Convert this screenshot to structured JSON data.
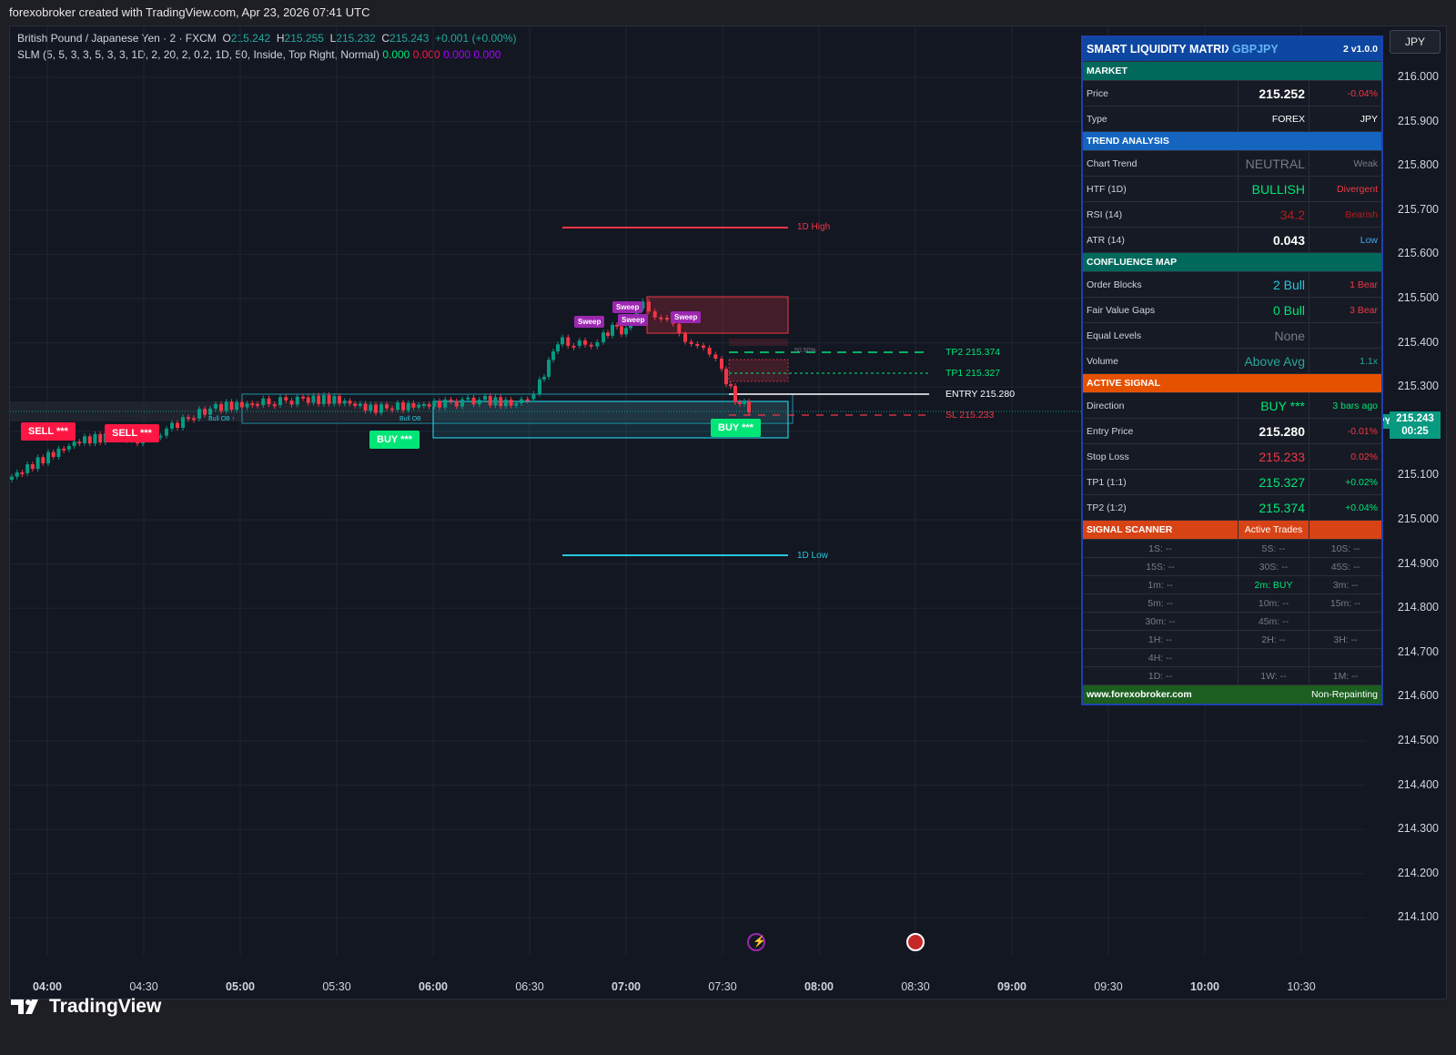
{
  "header": {
    "title": "forexobroker created with TradingView.com, Apr 23, 2026 07:41 UTC"
  },
  "legend": {
    "symbol": "British Pound / Japanese Yen · 2 · FXCM",
    "o_label": "O",
    "o": "215.242",
    "h_label": "H",
    "h": "215.255",
    "l_label": "L",
    "l": "215.232",
    "c_label": "C",
    "c": "215.243",
    "change": "+0.001 (+0.00%)",
    "indicator": "SLM (5, 5, 3, 3, 5, 3, 3, 1D, 2, 20, 2, 0.2, 1D, 50, Inside, Top Right, Normal)",
    "ind_v1": "0.000",
    "ind_v2": "0.000",
    "ind_v3": "0.000",
    "ind_v4": "0.000"
  },
  "currency_button": "JPY",
  "y_axis": [
    "216.000",
    "215.900",
    "215.800",
    "215.700",
    "215.600",
    "215.500",
    "215.400",
    "215.300",
    "215.200",
    "215.100",
    "215.000",
    "214.900",
    "214.800",
    "214.700",
    "214.600",
    "214.500",
    "214.400",
    "214.300",
    "214.200",
    "214.100"
  ],
  "x_axis": [
    {
      "label": "04:00",
      "bold": true
    },
    {
      "label": "04:30",
      "bold": false
    },
    {
      "label": "05:00",
      "bold": true
    },
    {
      "label": "05:30",
      "bold": false
    },
    {
      "label": "06:00",
      "bold": true
    },
    {
      "label": "06:30",
      "bold": false
    },
    {
      "label": "07:00",
      "bold": true
    },
    {
      "label": "07:30",
      "bold": false
    },
    {
      "label": "08:00",
      "bold": true
    },
    {
      "label": "08:30",
      "bold": false
    },
    {
      "label": "09:00",
      "bold": true
    },
    {
      "label": "09:30",
      "bold": false
    },
    {
      "label": "10:00",
      "bold": true
    },
    {
      "label": "10:30",
      "bold": false
    }
  ],
  "price_badge": {
    "symbol": "GBPJPY",
    "price": "215.243",
    "countdown": "00:25"
  },
  "levels": {
    "high_1d": "1D High",
    "low_1d": "1D Low",
    "tp2": "TP2 215.374",
    "tp1": "TP1 215.327",
    "entry": "ENTRY 215.280",
    "sl": "SL 215.233",
    "mid": "50.50%",
    "bull_ob": "Bull OB ↑",
    "bull_ob2": "Bull OB"
  },
  "signals": {
    "sell": "SELL ***",
    "buy": "BUY ***",
    "sweep": "Sweep"
  },
  "panel": {
    "title": "SMART LIQUIDITY MATRIX",
    "symbol": "GBPJPY",
    "version": "2  v1.0.0",
    "market": "MARKET",
    "price_label": "Price",
    "price": "215.252",
    "price_chg": "-0.04%",
    "type_label": "Type",
    "type": "FOREX",
    "type_ccy": "JPY",
    "trend": "TREND ANALYSIS",
    "chart_trend_label": "Chart Trend",
    "chart_trend": "NEUTRAL",
    "chart_trend_str": "Weak",
    "htf_label": "HTF (1D)",
    "htf": "BULLISH",
    "htf_note": "Divergent",
    "rsi_label": "RSI (14)",
    "rsi": "34.2",
    "rsi_note": "Bearish",
    "atr_label": "ATR (14)",
    "atr": "0.043",
    "atr_note": "Low",
    "confluence": "CONFLUENCE MAP",
    "ob_label": "Order Blocks",
    "ob": "2 Bull",
    "ob_bear": "1 Bear",
    "fvg_label": "Fair Value Gaps",
    "fvg": "0 Bull",
    "fvg_bear": "3 Bear",
    "eq_label": "Equal Levels",
    "eq": "None",
    "vol_label": "Volume",
    "vol": "Above Avg",
    "vol_x": "1.1x",
    "active": "ACTIVE SIGNAL",
    "dir_label": "Direction",
    "dir": "BUY ***",
    "dir_ago": "3 bars ago",
    "entry_label": "Entry Price",
    "entry": "215.280",
    "entry_pct": "-0.01%",
    "sl_label": "Stop Loss",
    "sl": "215.233",
    "sl_pct": "0.02%",
    "tp1_label": "TP1 (1:1)",
    "tp1": "215.327",
    "tp1_pct": "+0.02%",
    "tp2_label": "TP2 (1:2)",
    "tp2": "215.374",
    "tp2_pct": "+0.04%",
    "scanner": "SIGNAL SCANNER",
    "active_trades": "Active Trades",
    "scan": [
      [
        "1S: --",
        "5S: --",
        "10S: --"
      ],
      [
        "15S: --",
        "30S: --",
        "45S: --"
      ],
      [
        "1m: --",
        "2m: BUY",
        "3m: --"
      ],
      [
        "5m: --",
        "10m: --",
        "15m: --"
      ],
      [
        "30m: --",
        "45m: --",
        ""
      ],
      [
        "1H: --",
        "2H: --",
        "3H: --"
      ],
      [
        "4H: --",
        "",
        ""
      ],
      [
        "1D: --",
        "1W: --",
        "1M: --"
      ]
    ],
    "website": "www.forexobroker.com",
    "repaint": "Non-Repainting"
  },
  "footer": {
    "brand": "TradingView"
  },
  "colors": {
    "up": "#089981",
    "down": "#f23645",
    "bg": "#131722",
    "accent_buy": "#00e676",
    "accent_sell": "#ff1744"
  }
}
